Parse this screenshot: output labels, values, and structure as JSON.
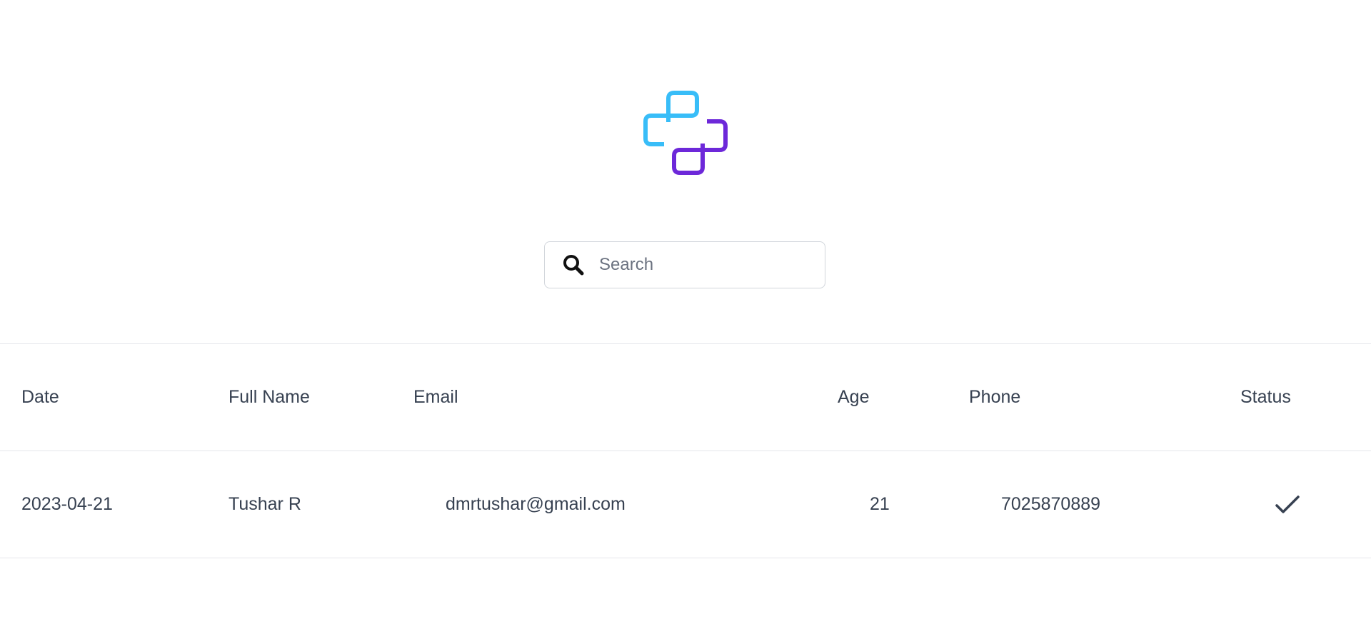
{
  "brand": {
    "logo_icon": "python-style-logo-icon",
    "colors": {
      "primary": "#38bdf8",
      "secondary": "#6d28d9"
    }
  },
  "search": {
    "icon": "search-icon",
    "placeholder": "Search",
    "value": ""
  },
  "table": {
    "headers": {
      "date": "Date",
      "full_name": "Full Name",
      "email": "Email",
      "age": "Age",
      "phone": "Phone",
      "status": "Status"
    },
    "rows": [
      {
        "date": "2023-04-21",
        "full_name": "Tushar R",
        "email": "dmrtushar@gmail.com",
        "age": "21",
        "phone": "7025870889",
        "status_icon": "checkmark-icon"
      }
    ]
  }
}
